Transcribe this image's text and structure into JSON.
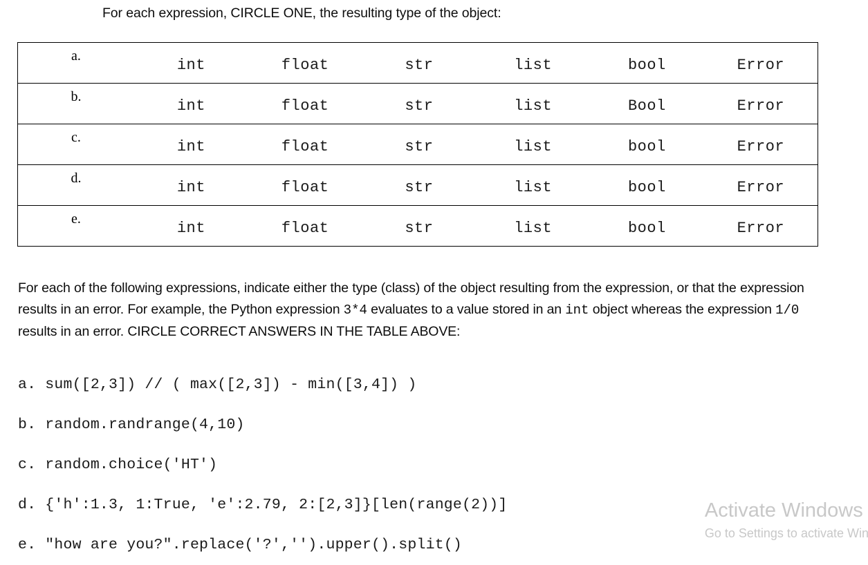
{
  "document": {
    "edge_marker": ".",
    "heading": "For each expression, CIRCLE  ONE, the resulting type of the object:"
  },
  "answer_table": {
    "columns": [
      "letter",
      "opt1",
      "opt2",
      "opt3",
      "opt4",
      "opt5",
      "opt6"
    ],
    "rows": [
      {
        "letter": "a.",
        "options": [
          "int",
          "float",
          "str",
          "list",
          "bool",
          "Error"
        ]
      },
      {
        "letter": "b.",
        "options": [
          "int",
          "float",
          "str",
          "list",
          "Bool",
          "Error"
        ]
      },
      {
        "letter": "c.",
        "options": [
          "int",
          "float",
          "str",
          "list",
          "bool",
          "Error"
        ]
      },
      {
        "letter": "d.",
        "options": [
          "int",
          "float",
          "str",
          "list",
          "bool",
          "Error"
        ]
      },
      {
        "letter": "e.",
        "options": [
          "int",
          "float",
          "str",
          "list",
          "bool",
          "Error"
        ]
      }
    ]
  },
  "instructions": {
    "seg1": "For each of the following expressions, indicate either the type (class) of the object resulting from the expression, or that the expression results in an error. For example, the Python expression ",
    "code1": "3*4",
    "seg2": " evaluates to a value stored in an ",
    "code2": "int",
    "seg3": " object whereas the expression ",
    "code3": "1/0",
    "seg4": " results in an error.  CIRCLE CORRECT ANSWERS IN THE TABLE ABOVE:"
  },
  "expressions": [
    {
      "label": "a.",
      "code": "a. sum([2,3]) // ( max([2,3]) - min([3,4]) )"
    },
    {
      "label": "b.",
      "code": "b. random.randrange(4,10)"
    },
    {
      "label": "c.",
      "code": "c. random.choice('HT')"
    },
    {
      "label": "d.",
      "code": "d. {'h':1.3, 1:True, 'e':2.79, 2:[2,3]}[len(range(2))]"
    },
    {
      "label": "e.",
      "code": "e. \"how are you?\".replace('?','').upper().split()"
    }
  ],
  "watermark": {
    "title": "Activate Windows",
    "subtitle": "Go to Settings to activate Windows."
  }
}
